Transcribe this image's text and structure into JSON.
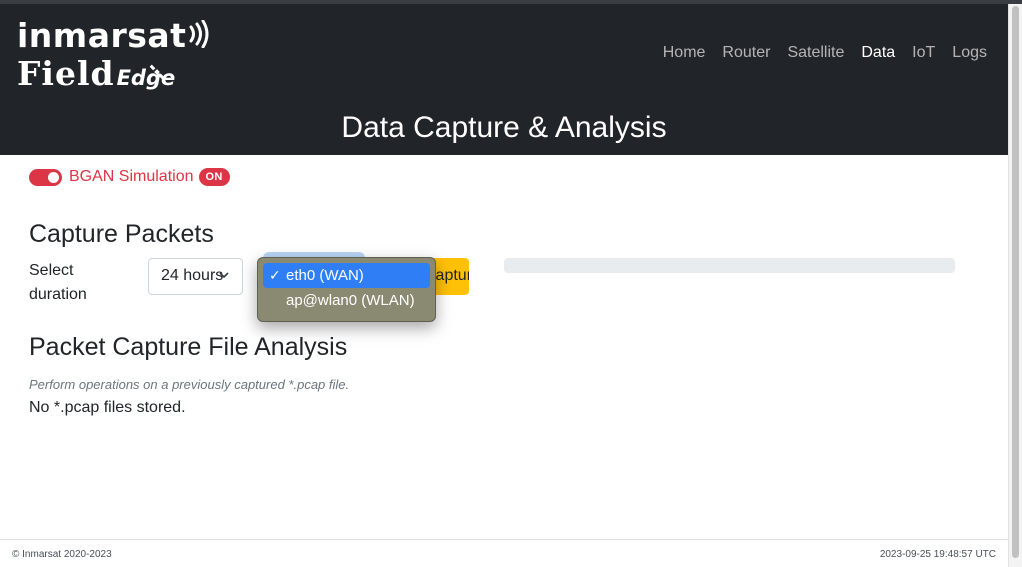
{
  "brand": {
    "name": "inmarsat",
    "product_main": "Field",
    "product_sub": "Edge"
  },
  "nav": {
    "items": [
      {
        "label": "Home",
        "active": false
      },
      {
        "label": "Router",
        "active": false
      },
      {
        "label": "Satellite",
        "active": false
      },
      {
        "label": "Data",
        "active": true
      },
      {
        "label": "IoT",
        "active": false
      },
      {
        "label": "Logs",
        "active": false
      }
    ]
  },
  "page": {
    "title": "Data Capture & Analysis"
  },
  "simulation": {
    "label": "BGAN Simulation",
    "badge": "ON",
    "enabled": true
  },
  "capture": {
    "heading": "Capture Packets",
    "duration_label": "Select duration",
    "duration_value": "24 hours",
    "button_label": "Capture",
    "progress": 0,
    "interface_options": [
      {
        "label": "eth0 (WAN)",
        "selected": true
      },
      {
        "label": "ap@wlan0 (WLAN)",
        "selected": false
      }
    ]
  },
  "analysis": {
    "heading": "Packet Capture File Analysis",
    "note": "Perform operations on a previously captured *.pcap file.",
    "empty_message": "No *.pcap files stored."
  },
  "footer": {
    "copyright": "© Inmarsat 2020-2023",
    "timestamp": "2023-09-25 19:48:57 UTC"
  },
  "colors": {
    "navbar": "#212529",
    "danger": "#dc3545",
    "warning": "#ffc107",
    "dropdown_highlight": "#2f7ef5"
  }
}
